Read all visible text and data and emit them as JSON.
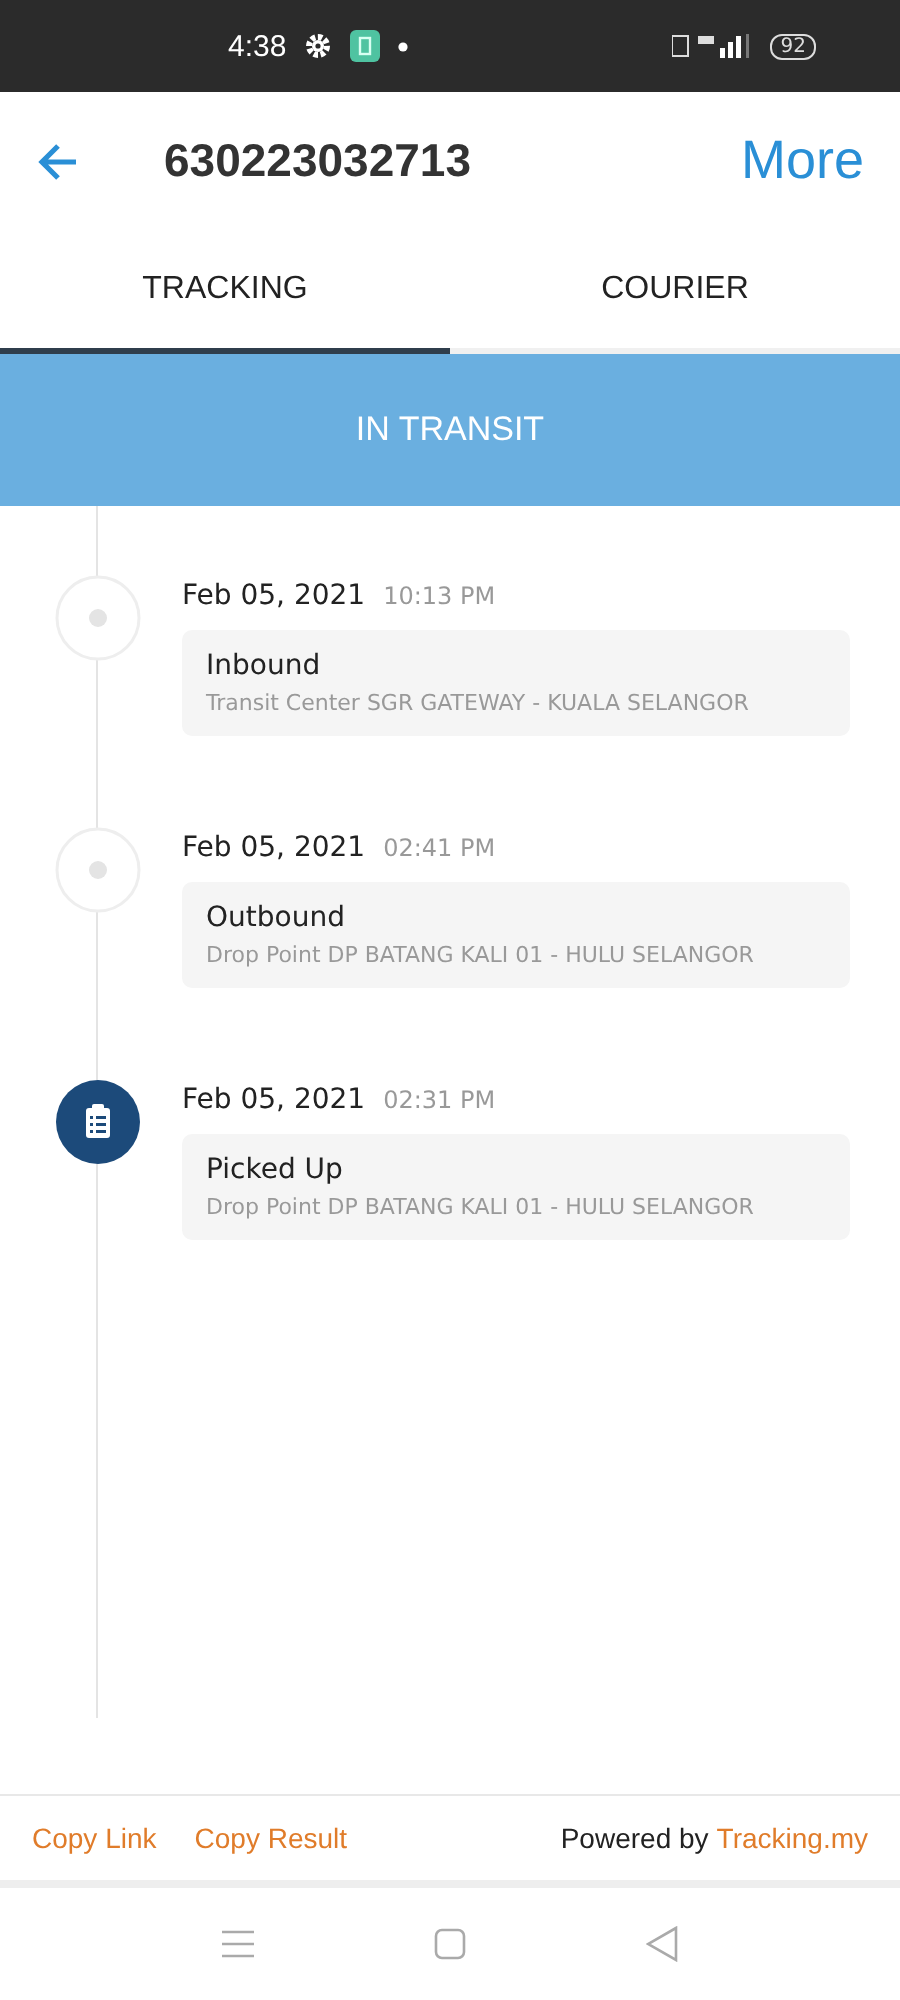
{
  "status_bar": {
    "time": "4:38",
    "battery": "92"
  },
  "header": {
    "title": "630223032713",
    "action": "More"
  },
  "tabs": [
    {
      "label": "TRACKING",
      "selected": true
    },
    {
      "label": "COURIER",
      "selected": false
    }
  ],
  "status": "IN TRANSIT",
  "events": [
    {
      "kind": "scan",
      "date": "Feb 05, 2021",
      "time": "10:13 PM",
      "title": "Inbound",
      "location": "Transit Center SGR GATEWAY - KUALA SELANGOR"
    },
    {
      "kind": "scan",
      "date": "Feb 05, 2021",
      "time": "02:41 PM",
      "title": "Outbound",
      "location": "Drop Point DP BATANG KALI 01 - HULU SELANGOR"
    },
    {
      "kind": "pickup",
      "date": "Feb 05, 2021",
      "time": "02:31 PM",
      "title": "Picked Up",
      "location": "Drop Point DP BATANG KALI 01 - HULU SELANGOR"
    }
  ],
  "footer": {
    "links": [
      "Copy Link",
      "Copy Result"
    ],
    "powered_prefix": "Powered by",
    "powered_link": "Tracking.my"
  }
}
